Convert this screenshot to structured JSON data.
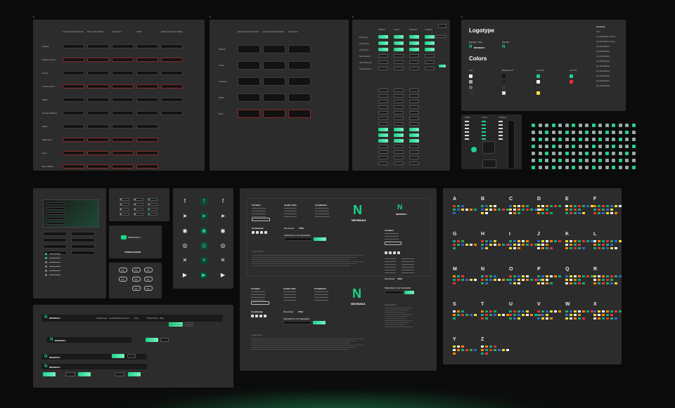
{
  "panel1": {
    "columns": [
      "Label Input description",
      "Hover description",
      "Label type",
      "Label",
      "Label type+Error+label"
    ],
    "rows": [
      "Default",
      "Default (error)",
      "Focus",
      "Focus (error)",
      "Filled",
      "Focused (filled)",
      "Filled",
      "Filled Error",
      "Error",
      "Error (filled)"
    ]
  },
  "panel2": {
    "columns": [
      "Label Input description",
      "Label Input description",
      "Label type"
    ],
    "rows": [
      "Default",
      "Focus",
      "Focused",
      "Filled",
      "Error"
    ]
  },
  "panel3": {
    "columns": [
      "Default",
      "Hover",
      "Pressed",
      "Loading"
    ],
    "rows": [
      "Primary L",
      "Primary M",
      "Primary S",
      "Secondary L",
      "Secondary M",
      "Secondary S"
    ]
  },
  "brand": {
    "logotype_title": "Logotype",
    "symbol_text_label": "Symbol + Text",
    "symbol_label": "Symbol",
    "brand_name": "NEOMAKA",
    "colors_title": "Colors",
    "text_label": "Text",
    "background_label": "Background",
    "controls_label": "Controls",
    "accents_label": "Accents",
    "typography_title": "Fonts",
    "typography": [
      "Headings",
      "Inter",
      "Fg 48 Medium 64 px",
      "Fg 40 Medium 56 px",
      "Fg 32 Medium",
      "Fg 28 Medium",
      "Fg 24 Medium",
      "Fg 20 Medium",
      "Fg 18 Medium",
      "Fg 16 Medium",
      "Fg 14 Medium",
      "Fg 12 Medium",
      "Fg 12 Regular"
    ]
  },
  "badge_names": [
    "White",
    "Green",
    "Gradient"
  ],
  "metatrader": {
    "label": "MetaTrader 5",
    "logo_text": "TRADELOCKER"
  },
  "tags": [
    "Tab",
    "Tab",
    "Tab",
    "Tab",
    "Tab",
    "Tab",
    "Tab",
    "Tab"
  ],
  "footer": {
    "brand": "NEOMAKA",
    "tagline": "BASED & FUTURE\nPROP FIRM",
    "contacts_title": "Contacts",
    "useful_title": "Useful Links",
    "compliance_title": "Compliance",
    "community_title": "Community",
    "we_accept": "We Accept",
    "visa": "VISA",
    "subscribe": "Subscribe to Our Newsletter",
    "subscribe_btn": "Subscribe",
    "legal_title": "Legal Notice",
    "support_btn": "Visit Support Center"
  },
  "navbar": {
    "brand": "NEOMAKA",
    "links": [
      "Challenges",
      "Certifications",
      "Payouts",
      "FAQ",
      "Partnership",
      "Blog"
    ],
    "cta": "Start Challenge",
    "login": "Log In",
    "lang": "EN"
  },
  "alphabet": [
    "A",
    "B",
    "C",
    "D",
    "E",
    "F",
    "G",
    "H",
    "I",
    "J",
    "K",
    "L",
    "M",
    "N",
    "O",
    "P",
    "Q",
    "R",
    "S",
    "T",
    "U",
    "V",
    "W",
    "X",
    "Y",
    "Z"
  ]
}
